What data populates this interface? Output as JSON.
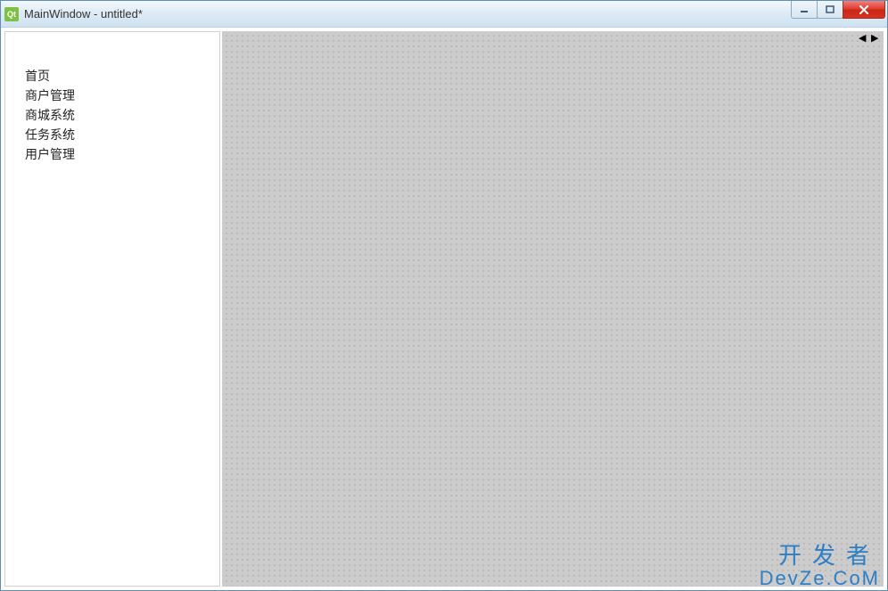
{
  "window": {
    "title": "MainWindow - untitled*",
    "app_icon_text": "Qt"
  },
  "sidebar": {
    "items": [
      {
        "label": "首页"
      },
      {
        "label": "商户管理"
      },
      {
        "label": "商城系统"
      },
      {
        "label": "任务系统"
      },
      {
        "label": "用户管理"
      }
    ]
  },
  "watermark": {
    "line1": "开发者",
    "line2": "DevZe.CoM"
  }
}
